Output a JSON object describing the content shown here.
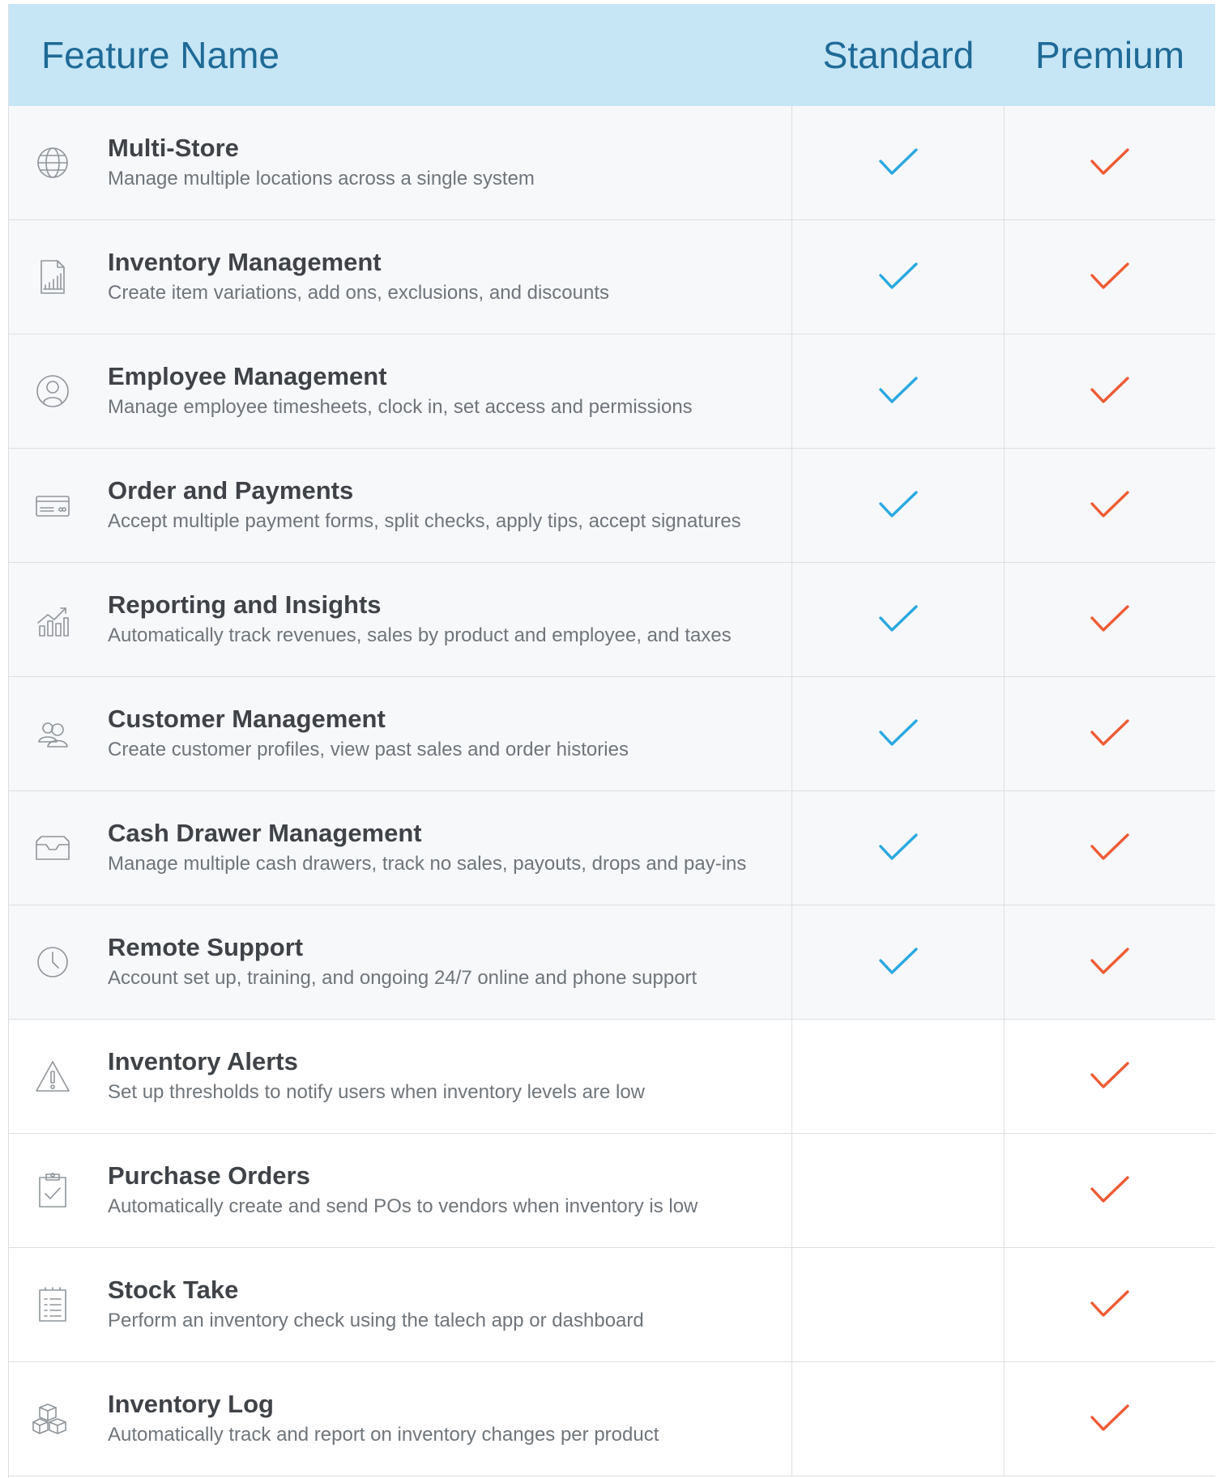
{
  "header": {
    "feature_name": "Feature Name",
    "standard": "Standard",
    "premium": "Premium"
  },
  "colors": {
    "header_bg": "#c6e6f6",
    "header_text": "#1f6a96",
    "standard_check": "#29a8e0",
    "premium_check": "#ee5b35"
  },
  "rows": [
    {
      "title": "Multi-Store",
      "desc": "Manage multiple locations across a single system",
      "icon": "globe-icon",
      "standard": true,
      "premium": true
    },
    {
      "title": "Inventory Management",
      "desc": "Create item variations, add ons, exclusions, and discounts",
      "icon": "document-chart-icon",
      "standard": true,
      "premium": true
    },
    {
      "title": "Employee Management",
      "desc": "Manage employee timesheets, clock in, set access and permissions",
      "icon": "user-circle-icon",
      "standard": true,
      "premium": true
    },
    {
      "title": "Order and Payments",
      "desc": "Accept multiple payment forms, split checks, apply tips, accept signatures",
      "icon": "credit-card-icon",
      "standard": true,
      "premium": true
    },
    {
      "title": "Reporting and Insights",
      "desc": "Automatically track revenues, sales by product and employee, and taxes",
      "icon": "growth-chart-icon",
      "standard": true,
      "premium": true
    },
    {
      "title": "Customer Management",
      "desc": "Create customer profiles, view past sales and order histories",
      "icon": "users-icon",
      "standard": true,
      "premium": true
    },
    {
      "title": "Cash Drawer Management",
      "desc": "Manage multiple cash drawers, track no sales, payouts, drops and pay-ins",
      "icon": "drawer-icon",
      "standard": true,
      "premium": true
    },
    {
      "title": "Remote Support",
      "desc": "Account set up, training, and ongoing 24/7 online and phone support",
      "icon": "clock-icon",
      "standard": true,
      "premium": true
    },
    {
      "title": "Inventory Alerts",
      "desc": "Set up thresholds to notify users when inventory levels are low",
      "icon": "warning-icon",
      "standard": false,
      "premium": true
    },
    {
      "title": "Purchase Orders",
      "desc": "Automatically create and send POs to vendors when inventory is low",
      "icon": "clipboard-check-icon",
      "standard": false,
      "premium": true
    },
    {
      "title": "Stock Take",
      "desc": "Perform an inventory check using the talech app or dashboard",
      "icon": "checklist-icon",
      "standard": false,
      "premium": true
    },
    {
      "title": "Inventory Log",
      "desc": "Automatically track and report on inventory changes per product",
      "icon": "boxes-icon",
      "standard": false,
      "premium": true
    }
  ]
}
